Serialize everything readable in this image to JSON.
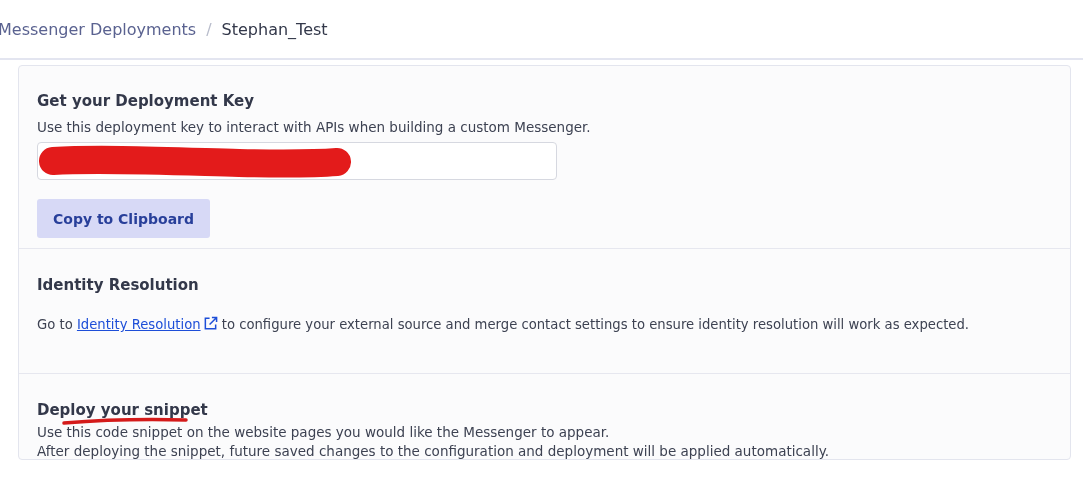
{
  "breadcrumb": {
    "parent": "Messenger Deployments",
    "separator": "/",
    "current": "Stephan_Test"
  },
  "deployment_key": {
    "title": "Get your Deployment Key",
    "description": "Use this deployment key to interact with APIs when building a custom Messenger.",
    "button": "Copy to Clipboard"
  },
  "identity_resolution": {
    "title": "Identity Resolution",
    "text_before": "Go to",
    "link": "Identity Resolution",
    "text_after": "to configure your external source and merge contact settings to ensure identity resolution will work as expected."
  },
  "snippet": {
    "title": "Deploy your snippet",
    "lines": [
      "Use this code snippet on the website pages you would like the Messenger to appear.",
      "After deploying the snippet, future saved changes to the configuration and deployment will be applied automatically."
    ]
  }
}
